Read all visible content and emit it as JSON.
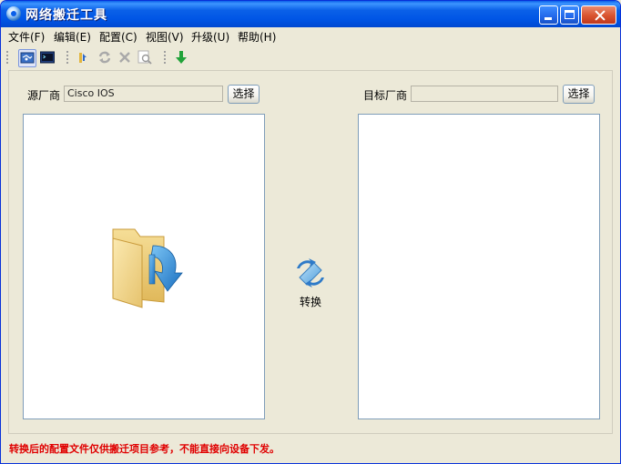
{
  "window": {
    "title": "网络搬迁工具"
  },
  "menu": [
    {
      "label": "文件(F)"
    },
    {
      "label": "编辑(E)"
    },
    {
      "label": "配置(C)"
    },
    {
      "label": "视图(V)"
    },
    {
      "label": "升级(U)"
    },
    {
      "label": "帮助(H)"
    }
  ],
  "toolbar": {
    "icons": [
      "network-view-icon",
      "terminal-icon",
      "open-config-icon",
      "refresh-icon",
      "delete-icon",
      "search-icon",
      "download-icon"
    ]
  },
  "source": {
    "label": "源厂商",
    "value": "Cisco IOS",
    "button": "选择"
  },
  "target": {
    "label": "目标厂商",
    "value": "",
    "button": "选择"
  },
  "convert": {
    "label": "转换"
  },
  "status": {
    "message": "转换后的配置文件仅供搬迁项目参考，不能直接向设备下发。"
  },
  "colors": {
    "titlebar": "#0055E5",
    "status_text": "#E00000",
    "window_bg": "#ECE9D8"
  }
}
